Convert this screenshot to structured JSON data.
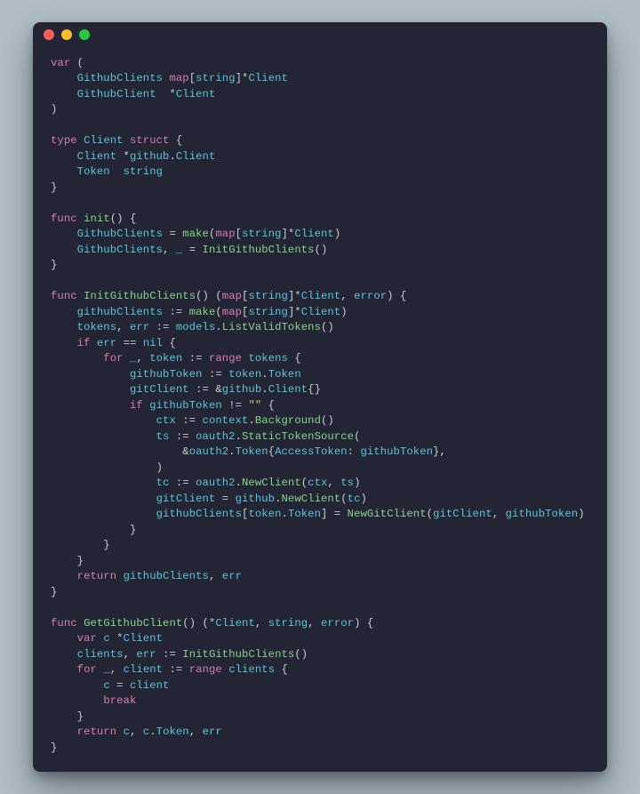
{
  "colors": {
    "background_page": "#b0bdc6",
    "background_window": "#232535",
    "keyword": "#d97eaa",
    "identifier": "#5cc6d6",
    "funcname": "#88d48c",
    "string": "#e2b958",
    "default": "#c9cdd7",
    "traffic_red": "#ff5f56",
    "traffic_yellow": "#ffbd2e",
    "traffic_green": "#27c93f"
  },
  "code_tokens": [
    [
      [
        "kw",
        "var"
      ],
      [
        "pun",
        " ("
      ]
    ],
    [
      [
        "pun",
        "    "
      ],
      [
        "id",
        "GithubClients"
      ],
      [
        "pun",
        " "
      ],
      [
        "kw",
        "map"
      ],
      [
        "pun",
        "["
      ],
      [
        "typ",
        "string"
      ],
      [
        "pun",
        "]*"
      ],
      [
        "typ",
        "Client"
      ]
    ],
    [
      [
        "pun",
        "    "
      ],
      [
        "id",
        "GithubClient"
      ],
      [
        "pun",
        "  *"
      ],
      [
        "typ",
        "Client"
      ]
    ],
    [
      [
        "pun",
        ")"
      ]
    ],
    [],
    [
      [
        "kw",
        "type"
      ],
      [
        "pun",
        " "
      ],
      [
        "typ",
        "Client"
      ],
      [
        "pun",
        " "
      ],
      [
        "kw",
        "struct"
      ],
      [
        "pun",
        " {"
      ]
    ],
    [
      [
        "pun",
        "    "
      ],
      [
        "id",
        "Client"
      ],
      [
        "pun",
        " *"
      ],
      [
        "id",
        "github"
      ],
      [
        "white",
        "."
      ],
      [
        "typ",
        "Client"
      ]
    ],
    [
      [
        "pun",
        "    "
      ],
      [
        "id",
        "Token"
      ],
      [
        "pun",
        "  "
      ],
      [
        "typ",
        "string"
      ]
    ],
    [
      [
        "pun",
        "}"
      ]
    ],
    [],
    [
      [
        "kw",
        "func"
      ],
      [
        "pun",
        " "
      ],
      [
        "fn",
        "init"
      ],
      [
        "pun",
        "() {"
      ]
    ],
    [
      [
        "pun",
        "    "
      ],
      [
        "id",
        "GithubClients"
      ],
      [
        "pun",
        " = "
      ],
      [
        "fn",
        "make"
      ],
      [
        "pun",
        "("
      ],
      [
        "kw",
        "map"
      ],
      [
        "pun",
        "["
      ],
      [
        "typ",
        "string"
      ],
      [
        "pun",
        "]*"
      ],
      [
        "typ",
        "Client"
      ],
      [
        "pun",
        ")"
      ]
    ],
    [
      [
        "pun",
        "    "
      ],
      [
        "id",
        "GithubClients"
      ],
      [
        "pun",
        ", "
      ],
      [
        "id",
        "_"
      ],
      [
        "pun",
        " = "
      ],
      [
        "fn",
        "InitGithubClients"
      ],
      [
        "pun",
        "()"
      ]
    ],
    [
      [
        "pun",
        "}"
      ]
    ],
    [],
    [
      [
        "kw",
        "func"
      ],
      [
        "pun",
        " "
      ],
      [
        "fn",
        "InitGithubClients"
      ],
      [
        "pun",
        "() ("
      ],
      [
        "kw",
        "map"
      ],
      [
        "pun",
        "["
      ],
      [
        "typ",
        "string"
      ],
      [
        "pun",
        "]*"
      ],
      [
        "typ",
        "Client"
      ],
      [
        "pun",
        ", "
      ],
      [
        "typ",
        "error"
      ],
      [
        "pun",
        ") {"
      ]
    ],
    [
      [
        "pun",
        "    "
      ],
      [
        "id",
        "githubClients"
      ],
      [
        "pun",
        " := "
      ],
      [
        "fn",
        "make"
      ],
      [
        "pun",
        "("
      ],
      [
        "kw",
        "map"
      ],
      [
        "pun",
        "["
      ],
      [
        "typ",
        "string"
      ],
      [
        "pun",
        "]*"
      ],
      [
        "typ",
        "Client"
      ],
      [
        "pun",
        ")"
      ]
    ],
    [
      [
        "pun",
        "    "
      ],
      [
        "id",
        "tokens"
      ],
      [
        "pun",
        ", "
      ],
      [
        "id",
        "err"
      ],
      [
        "pun",
        " := "
      ],
      [
        "id",
        "models"
      ],
      [
        "white",
        "."
      ],
      [
        "fn",
        "ListValidTokens"
      ],
      [
        "pun",
        "()"
      ]
    ],
    [
      [
        "pun",
        "    "
      ],
      [
        "kw",
        "if"
      ],
      [
        "pun",
        " "
      ],
      [
        "id",
        "err"
      ],
      [
        "pun",
        " == "
      ],
      [
        "id",
        "nil"
      ],
      [
        "pun",
        " {"
      ]
    ],
    [
      [
        "pun",
        "        "
      ],
      [
        "kw",
        "for"
      ],
      [
        "pun",
        " "
      ],
      [
        "id",
        "_"
      ],
      [
        "pun",
        ", "
      ],
      [
        "id",
        "token"
      ],
      [
        "pun",
        " := "
      ],
      [
        "kw",
        "range"
      ],
      [
        "pun",
        " "
      ],
      [
        "id",
        "tokens"
      ],
      [
        "pun",
        " {"
      ]
    ],
    [
      [
        "pun",
        "            "
      ],
      [
        "id",
        "githubToken"
      ],
      [
        "pun",
        " := "
      ],
      [
        "id",
        "token"
      ],
      [
        "white",
        "."
      ],
      [
        "id",
        "Token"
      ]
    ],
    [
      [
        "pun",
        "            "
      ],
      [
        "id",
        "gitClient"
      ],
      [
        "pun",
        " := &"
      ],
      [
        "id",
        "github"
      ],
      [
        "white",
        "."
      ],
      [
        "typ",
        "Client"
      ],
      [
        "pun",
        "{}"
      ]
    ],
    [
      [
        "pun",
        "            "
      ],
      [
        "kw",
        "if"
      ],
      [
        "pun",
        " "
      ],
      [
        "id",
        "githubToken"
      ],
      [
        "pun",
        " != "
      ],
      [
        "str",
        "\"\""
      ],
      [
        "pun",
        " {"
      ]
    ],
    [
      [
        "pun",
        "                "
      ],
      [
        "id",
        "ctx"
      ],
      [
        "pun",
        " := "
      ],
      [
        "id",
        "context"
      ],
      [
        "white",
        "."
      ],
      [
        "fn",
        "Background"
      ],
      [
        "pun",
        "()"
      ]
    ],
    [
      [
        "pun",
        "                "
      ],
      [
        "id",
        "ts"
      ],
      [
        "pun",
        " := "
      ],
      [
        "id",
        "oauth2"
      ],
      [
        "white",
        "."
      ],
      [
        "fn",
        "StaticTokenSource"
      ],
      [
        "pun",
        "("
      ]
    ],
    [
      [
        "pun",
        "                    &"
      ],
      [
        "id",
        "oauth2"
      ],
      [
        "white",
        "."
      ],
      [
        "typ",
        "Token"
      ],
      [
        "pun",
        "{"
      ],
      [
        "id",
        "AccessToken"
      ],
      [
        "pun",
        ": "
      ],
      [
        "id",
        "githubToken"
      ],
      [
        "pun",
        "},"
      ]
    ],
    [
      [
        "pun",
        "                )"
      ]
    ],
    [
      [
        "pun",
        "                "
      ],
      [
        "id",
        "tc"
      ],
      [
        "pun",
        " := "
      ],
      [
        "id",
        "oauth2"
      ],
      [
        "white",
        "."
      ],
      [
        "fn",
        "NewClient"
      ],
      [
        "pun",
        "("
      ],
      [
        "id",
        "ctx"
      ],
      [
        "pun",
        ", "
      ],
      [
        "id",
        "ts"
      ],
      [
        "pun",
        ")"
      ]
    ],
    [
      [
        "pun",
        "                "
      ],
      [
        "id",
        "gitClient"
      ],
      [
        "pun",
        " = "
      ],
      [
        "id",
        "github"
      ],
      [
        "white",
        "."
      ],
      [
        "fn",
        "NewClient"
      ],
      [
        "pun",
        "("
      ],
      [
        "id",
        "tc"
      ],
      [
        "pun",
        ")"
      ]
    ],
    [
      [
        "pun",
        "                "
      ],
      [
        "id",
        "githubClients"
      ],
      [
        "pun",
        "["
      ],
      [
        "id",
        "token"
      ],
      [
        "white",
        "."
      ],
      [
        "id",
        "Token"
      ],
      [
        "pun",
        "] = "
      ],
      [
        "fn",
        "NewGitClient"
      ],
      [
        "pun",
        "("
      ],
      [
        "id",
        "gitClient"
      ],
      [
        "pun",
        ", "
      ],
      [
        "id",
        "githubToken"
      ],
      [
        "pun",
        ")"
      ]
    ],
    [
      [
        "pun",
        "            }"
      ]
    ],
    [
      [
        "pun",
        "        }"
      ]
    ],
    [
      [
        "pun",
        "    }"
      ]
    ],
    [
      [
        "pun",
        "    "
      ],
      [
        "kw",
        "return"
      ],
      [
        "pun",
        " "
      ],
      [
        "id",
        "githubClients"
      ],
      [
        "pun",
        ", "
      ],
      [
        "id",
        "err"
      ]
    ],
    [
      [
        "pun",
        "}"
      ]
    ],
    [],
    [
      [
        "kw",
        "func"
      ],
      [
        "pun",
        " "
      ],
      [
        "fn",
        "GetGithubClient"
      ],
      [
        "pun",
        "() (*"
      ],
      [
        "typ",
        "Client"
      ],
      [
        "pun",
        ", "
      ],
      [
        "typ",
        "string"
      ],
      [
        "pun",
        ", "
      ],
      [
        "typ",
        "error"
      ],
      [
        "pun",
        ") {"
      ]
    ],
    [
      [
        "pun",
        "    "
      ],
      [
        "kw",
        "var"
      ],
      [
        "pun",
        " "
      ],
      [
        "id",
        "c"
      ],
      [
        "pun",
        " *"
      ],
      [
        "typ",
        "Client"
      ]
    ],
    [
      [
        "pun",
        "    "
      ],
      [
        "id",
        "clients"
      ],
      [
        "pun",
        ", "
      ],
      [
        "id",
        "err"
      ],
      [
        "pun",
        " := "
      ],
      [
        "fn",
        "InitGithubClients"
      ],
      [
        "pun",
        "()"
      ]
    ],
    [
      [
        "pun",
        "    "
      ],
      [
        "kw",
        "for"
      ],
      [
        "pun",
        " "
      ],
      [
        "id",
        "_"
      ],
      [
        "pun",
        ", "
      ],
      [
        "id",
        "client"
      ],
      [
        "pun",
        " := "
      ],
      [
        "kw",
        "range"
      ],
      [
        "pun",
        " "
      ],
      [
        "id",
        "clients"
      ],
      [
        "pun",
        " {"
      ]
    ],
    [
      [
        "pun",
        "        "
      ],
      [
        "id",
        "c"
      ],
      [
        "pun",
        " = "
      ],
      [
        "id",
        "client"
      ]
    ],
    [
      [
        "pun",
        "        "
      ],
      [
        "kw",
        "break"
      ]
    ],
    [
      [
        "pun",
        "    }"
      ]
    ],
    [
      [
        "pun",
        "    "
      ],
      [
        "kw",
        "return"
      ],
      [
        "pun",
        " "
      ],
      [
        "id",
        "c"
      ],
      [
        "pun",
        ", "
      ],
      [
        "id",
        "c"
      ],
      [
        "white",
        "."
      ],
      [
        "id",
        "Token"
      ],
      [
        "pun",
        ", "
      ],
      [
        "id",
        "err"
      ]
    ],
    [
      [
        "pun",
        "}"
      ]
    ]
  ]
}
